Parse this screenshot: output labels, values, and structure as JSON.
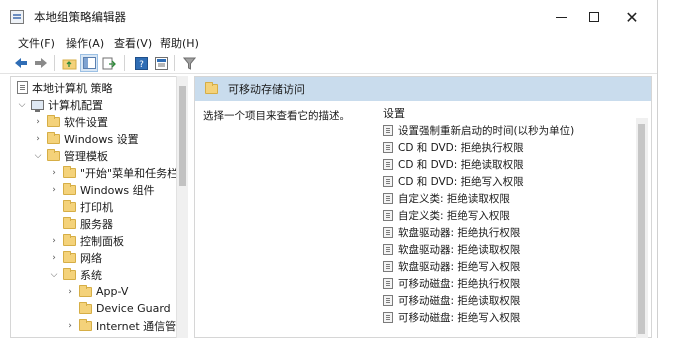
{
  "window": {
    "title": "本地组策略编辑器",
    "close_glyph": "✕"
  },
  "menu": [
    {
      "label": "文件(F)"
    },
    {
      "label": "操作(A)"
    },
    {
      "label": "查看(V)"
    },
    {
      "label": "帮助(H)"
    }
  ],
  "tree": {
    "items": [
      {
        "label": "本地计算机 策略",
        "chevron": ""
      },
      {
        "label": "计算机配置",
        "chevron": "⌵"
      },
      {
        "label": "软件设置",
        "chevron": "›"
      },
      {
        "label": "Windows 设置",
        "chevron": "›"
      },
      {
        "label": "管理模板",
        "chevron": "⌵"
      },
      {
        "label": "\"开始\"菜单和任务栏",
        "chevron": "›"
      },
      {
        "label": "Windows 组件",
        "chevron": "›"
      },
      {
        "label": "打印机",
        "chevron": ""
      },
      {
        "label": "服务器",
        "chevron": ""
      },
      {
        "label": "控制面板",
        "chevron": "›"
      },
      {
        "label": "网络",
        "chevron": "›"
      },
      {
        "label": "系统",
        "chevron": "⌵"
      },
      {
        "label": "App-V",
        "chevron": "›"
      },
      {
        "label": "Device Guard",
        "chevron": ""
      },
      {
        "label": "Internet 通信管理",
        "chevron": "›"
      }
    ]
  },
  "details": {
    "path_label": "可移动存储访问",
    "description_prompt": "选择一个项目来查看它的描述。",
    "settings_header": "设置",
    "settings": [
      "设置强制重新启动的时间(以秒为单位)",
      "CD 和 DVD: 拒绝执行权限",
      "CD 和 DVD: 拒绝读取权限",
      "CD 和 DVD: 拒绝写入权限",
      "自定义类: 拒绝读取权限",
      "自定义类: 拒绝写入权限",
      "软盘驱动器: 拒绝执行权限",
      "软盘驱动器: 拒绝读取权限",
      "软盘驱动器: 拒绝写入权限",
      "可移动磁盘: 拒绝执行权限",
      "可移动磁盘: 拒绝读取权限",
      "可移动磁盘: 拒绝写入权限"
    ]
  },
  "colors": {
    "path_bar": "#c9dced",
    "folder": "#f4d27a",
    "arrow_blue": "#2f6db5"
  }
}
